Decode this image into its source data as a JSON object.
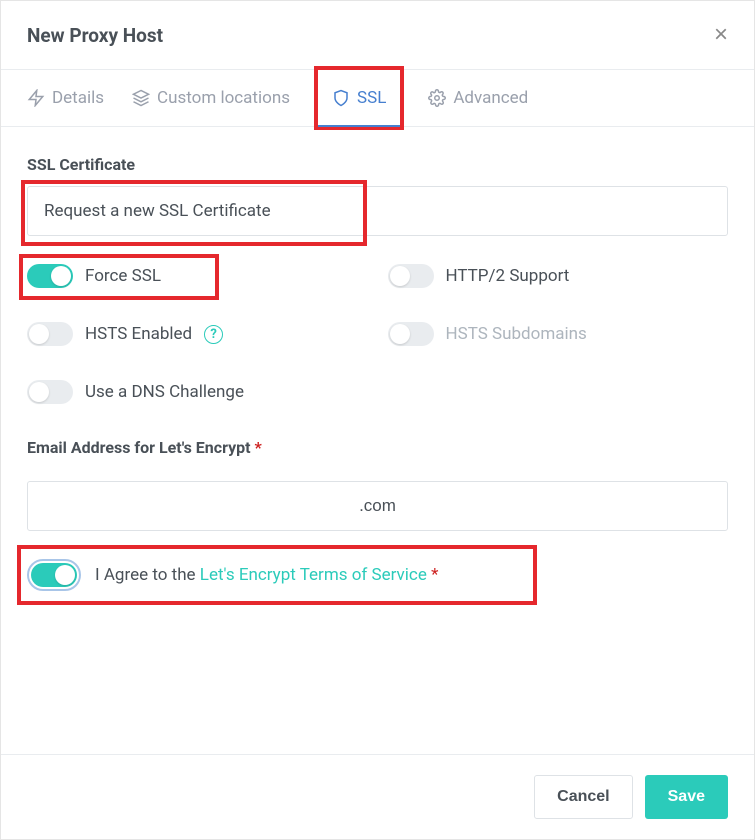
{
  "modal": {
    "title": "New Proxy Host",
    "close_label": "×"
  },
  "tabs": {
    "details": "Details",
    "custom_locations": "Custom locations",
    "ssl": "SSL",
    "advanced": "Advanced"
  },
  "ssl": {
    "cert_label": "SSL Certificate",
    "cert_value": "Request a new SSL Certificate",
    "toggles": {
      "force_ssl": {
        "label": "Force SSL",
        "on": true
      },
      "http2": {
        "label": "HTTP/2 Support",
        "on": false
      },
      "hsts": {
        "label": "HSTS Enabled",
        "on": false
      },
      "hsts_sub": {
        "label": "HSTS Subdomains",
        "on": false,
        "disabled": true
      },
      "dns": {
        "label": "Use a DNS Challenge",
        "on": false
      }
    },
    "email_label": "Email Address for Let's Encrypt",
    "email_value": ".com",
    "agree_prefix": "I Agree to the ",
    "agree_link": "Let's Encrypt Terms of Service"
  },
  "footer": {
    "cancel": "Cancel",
    "save": "Save"
  }
}
